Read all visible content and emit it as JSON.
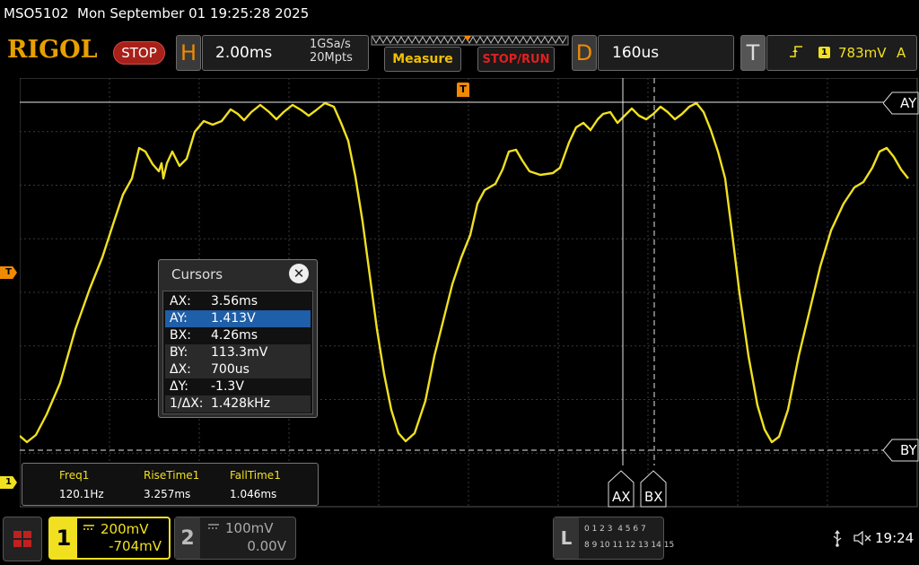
{
  "status": {
    "model": "MSO5102",
    "datetime": "Mon September 01 19:25:28 2025"
  },
  "topbar": {
    "brand": "RIGOL",
    "run_state": "STOP",
    "h_letter": "H",
    "timebase": "2.00ms",
    "sample_rate": "1GSa/s",
    "memory_depth": "20Mpts",
    "measure_label": "Measure",
    "stoprun_label": "STOP/RUN",
    "d_letter": "D",
    "delay": "160us",
    "t_letter": "T",
    "trigger_source": "1",
    "trigger_level": "783mV",
    "trigger_mode": "A"
  },
  "cursor_labels": {
    "ay": "AY",
    "by": "BY",
    "ax": "AX",
    "bx": "BX"
  },
  "cursors_panel": {
    "title": "Cursors",
    "rows": [
      {
        "key": "AX:",
        "value": "3.56ms"
      },
      {
        "key": "AY:",
        "value": "1.413V"
      },
      {
        "key": "BX:",
        "value": "4.26ms"
      },
      {
        "key": "BY:",
        "value": "113.3mV"
      },
      {
        "key": "ΔX:",
        "value": "700us"
      },
      {
        "key": "ΔY:",
        "value": "-1.3V"
      },
      {
        "key": "1/ΔX:",
        "value": "1.428kHz"
      }
    ],
    "selected_row": "AY:"
  },
  "measurements": [
    {
      "name": "Freq1",
      "value": "120.1Hz"
    },
    {
      "name": "RiseTime1",
      "value": "3.257ms"
    },
    {
      "name": "FallTime1",
      "value": "1.046ms"
    }
  ],
  "channels": [
    {
      "number": "1",
      "scale": "200mV",
      "offset": "-704mV",
      "active": true
    },
    {
      "number": "2",
      "scale": "100mV",
      "offset": "0.00V",
      "active": false
    }
  ],
  "logic": {
    "letter": "L",
    "row1": "0 1 2 3  4 5 6 7",
    "row2": "8 9 10 11 12 13 14 15"
  },
  "markers": {
    "trigger_marker": "T",
    "ch1_marker": "1"
  },
  "clock": "19:24",
  "colors": {
    "ch1": "#f0e020",
    "accent": "#f08a00",
    "stop": "#a8201a",
    "selected": "#1f5ea8"
  }
}
